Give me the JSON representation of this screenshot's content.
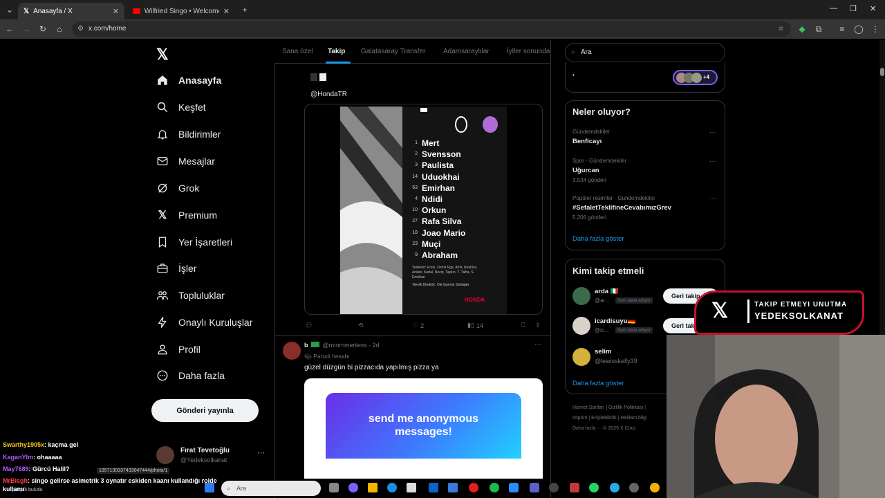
{
  "browser": {
    "tabs": [
      {
        "title": "Anasayfa / X",
        "active": true
      },
      {
        "title": "Wilfried Singo • Welcome to G...",
        "active": false
      }
    ],
    "url": "x.com/home"
  },
  "nav": {
    "items": [
      {
        "label": "Anasayfa",
        "icon": "home-icon"
      },
      {
        "label": "Keşfet",
        "icon": "search-icon"
      },
      {
        "label": "Bildirimler",
        "icon": "bell-icon"
      },
      {
        "label": "Mesajlar",
        "icon": "mail-icon"
      },
      {
        "label": "Grok",
        "icon": "grok-icon"
      },
      {
        "label": "Premium",
        "icon": "x-icon"
      },
      {
        "label": "Yer İşaretleri",
        "icon": "bookmark-icon"
      },
      {
        "label": "İşler",
        "icon": "briefcase-icon"
      },
      {
        "label": "Topluluklar",
        "icon": "people-icon"
      },
      {
        "label": "Onaylı Kuruluşlar",
        "icon": "lightning-icon"
      },
      {
        "label": "Profil",
        "icon": "person-icon"
      },
      {
        "label": "Daha fazla",
        "icon": "more-circle-icon"
      }
    ],
    "post_button": "Gönderi yayınla",
    "profile_name": "Fırat Tevetoğlu",
    "profile_handle": "@Yedeksolkanat"
  },
  "feed_tabs": [
    "Sana özel",
    "Takip",
    "Galatasaray Transfer",
    "Adamsaraylılar",
    "İyller sonunda"
  ],
  "tweet1": {
    "mention": "@HondaTR",
    "lineup": [
      {
        "num": "1",
        "name": "Mert"
      },
      {
        "num": "2",
        "name": "Svensson"
      },
      {
        "num": "3",
        "name": "Paulista"
      },
      {
        "num": "14",
        "name": "Uduokhai"
      },
      {
        "num": "53",
        "name": "Emirhan"
      },
      {
        "num": "4",
        "name": "Ndidi"
      },
      {
        "num": "10",
        "name": "Orkun"
      },
      {
        "num": "27",
        "name": "Rafa Silva"
      },
      {
        "num": "18",
        "name": "Joao Mario"
      },
      {
        "num": "23",
        "name": "Muçi"
      },
      {
        "num": "9",
        "name": "Abraham"
      }
    ],
    "card_footer_brand": "HONDA",
    "likes": "2",
    "views": "14"
  },
  "tweet2": {
    "author": "b",
    "handle": "@mmmmertens · 2d",
    "badge": "Parodi hesabı",
    "text": "güzel düzgün bi pizzacıda yapılmış pizza ya",
    "card_text": "send me anonymous messages!"
  },
  "right": {
    "search_placeholder": "Ara",
    "plus_count": "+4",
    "trends_title": "Neler oluyor?",
    "trends": [
      {
        "context": "Gündemdekiler",
        "name": "Benficayı",
        "count": ""
      },
      {
        "context": "Spor · Gündemdekiler",
        "name": "Uğurcan",
        "count": "3.534 gönderi"
      },
      {
        "context": "Popüler resimler · Gündemdekiler",
        "name": "#SefaletTeklifineCevabımızGrev",
        "count": "5.206 gönderi"
      }
    ],
    "show_more": "Daha fazla göster",
    "who_title": "Kimi takip etmeli",
    "who": [
      {
        "name": "arda 🇮🇹",
        "handle": "@ar...",
        "tag": "Seni takip ediyor",
        "button": "Geri takip et"
      },
      {
        "name": "icardisuyu🇩🇪",
        "handle": "@ic...",
        "tag": "Seni takip ediyor",
        "button": "Geri takip et"
      },
      {
        "name": "selim",
        "handle": "@lewisskelly39",
        "tag": "",
        "button": ""
      }
    ],
    "who_more": "Daha fazla göster",
    "footer1": "Hizmet Şartları  |  Gizlilik Politikası  |",
    "footer2": "Imprint  |  Erişilebilirlik  |  Reklam bilgi",
    "footer3": "Daha fazla ···  © 2025 X Corp."
  },
  "overlay": {
    "banner_line1": "TAKIP ETMEYI UNUTMA",
    "banner_line2": "YEDEKSOLKANAT",
    "chat": [
      {
        "user": "Swarthy1905x",
        "msg": ": kaçma gel",
        "color": "#f5c518"
      },
      {
        "user": "KaganYlm",
        "msg": ": ohaaaaa",
        "color": "#b05cff"
      },
      {
        "user": "May7689",
        "msg": ": Gürcü Halil?",
        "color": "#b05cff"
      },
      {
        "user": "MrBisgh",
        "msg": ": singo gelirse asimetrik 3 oynatır eskiden kaanı kullandığı rolde kullanır",
        "color": "#ff4040"
      }
    ],
    "status_url": "1957130337433047444/photo/1",
    "weather": "parçalı bulutlu",
    "taskbar_search": "Ara"
  }
}
